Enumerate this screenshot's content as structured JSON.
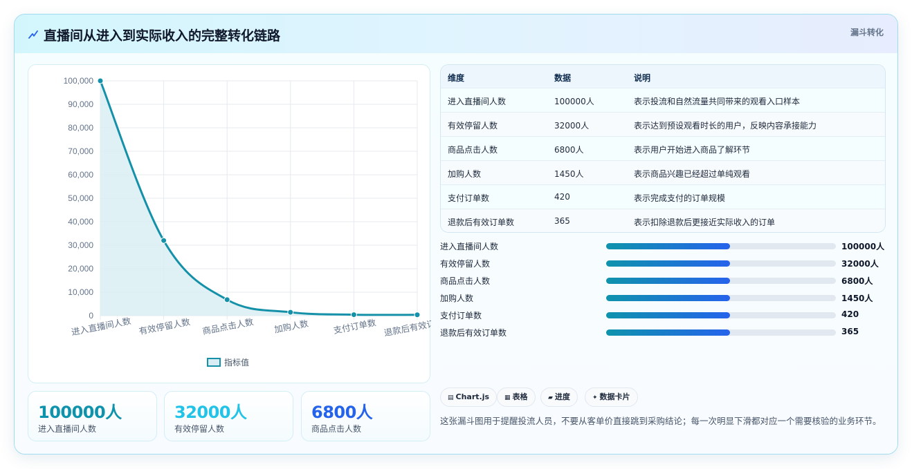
{
  "header": {
    "icon": "zigzag-arrow-icon",
    "title": "直播间从进入到实际收入的完整转化链路",
    "badge": "漏斗转化"
  },
  "chart_data": {
    "type": "line",
    "categories": [
      "进入直播间人数",
      "有效停留人数",
      "商品点击人数",
      "加购人数",
      "支付订单数",
      "退款后有效订单数"
    ],
    "series": [
      {
        "name": "指标值",
        "values": [
          100000,
          32000,
          6800,
          1450,
          420,
          365
        ]
      }
    ],
    "y_ticks": [
      "100,000",
      "90,000",
      "80,000",
      "70,000",
      "60,000",
      "50,000",
      "40,000",
      "30,000",
      "20,000",
      "10,000",
      "0"
    ],
    "ylim": [
      0,
      100000
    ],
    "grid": true,
    "legend_position": "bottom",
    "fill": true,
    "colors": {
      "line": "#1491a8",
      "fill": "#d8edf3"
    }
  },
  "kpis": [
    {
      "value": "100000人",
      "label": "进入直播间人数",
      "color": "#0f93ac"
    },
    {
      "value": "32000人",
      "label": "有效停留人数",
      "color": "#22c3e6"
    },
    {
      "value": "6800人",
      "label": "商品点击人数",
      "color": "#2563eb"
    }
  ],
  "table": {
    "headers": [
      "维度",
      "数据",
      "说明"
    ],
    "rows": [
      [
        "进入直播间人数",
        "100000人",
        "表示投流和自然流量共同带来的观看入口样本"
      ],
      [
        "有效停留人数",
        "32000人",
        "表示达到预设观看时长的用户，反映内容承接能力"
      ],
      [
        "商品点击人数",
        "6800人",
        "表示用户开始进入商品了解环节"
      ],
      [
        "加购人数",
        "1450人",
        "表示商品兴趣已经超过单纯观看"
      ],
      [
        "支付订单数",
        "420",
        "表示完成支付的订单规模"
      ],
      [
        "退款后有效订单数",
        "365",
        "表示扣除退款后更接近实际收入的订单"
      ]
    ]
  },
  "progress": [
    {
      "label": "进入直播间人数",
      "value": "100000人",
      "fraction": 0.54
    },
    {
      "label": "有效停留人数",
      "value": "32000人",
      "fraction": 0.54
    },
    {
      "label": "商品点击人数",
      "value": "6800人",
      "fraction": 0.54
    },
    {
      "label": "加购人数",
      "value": "1450人",
      "fraction": 0.54
    },
    {
      "label": "支付订单数",
      "value": "420",
      "fraction": 0.54
    },
    {
      "label": "退款后有效订单数",
      "value": "365",
      "fraction": 0.54
    }
  ],
  "tags": [
    {
      "icon": "chart-icon",
      "glyph": "▤",
      "label": "Chart.js"
    },
    {
      "icon": "table-icon",
      "glyph": "▦",
      "label": "表格"
    },
    {
      "icon": "progress-icon",
      "glyph": "▰",
      "label": "进度"
    },
    {
      "icon": "sparkle-icon",
      "glyph": "✦",
      "label": "数据卡片"
    }
  ],
  "note": "这张漏斗图用于提醒投流人员，不要从客单价直接跳到采购结论；每一次明显下滑都对应一个需要核验的业务环节。"
}
